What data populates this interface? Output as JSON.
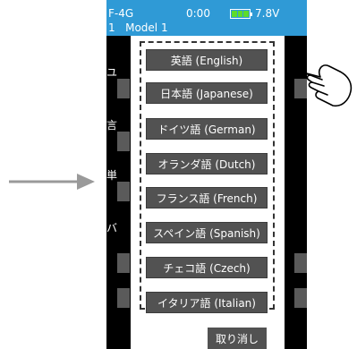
{
  "status_bar": {
    "system": "F-4G",
    "clock": "0:00",
    "voltage": "7.8V",
    "model_number": "1",
    "model_name": "Model 1",
    "battery_icon": "battery-icon"
  },
  "background_labels": [
    "ユ",
    "言",
    "単",
    "バ"
  ],
  "language_options": [
    "英語 (English)",
    "日本語 (Japanese)",
    "ドイツ語 (German)",
    "オランダ語 (Dutch)",
    "フランス語 (French)",
    "スペイン語 (Spanish)",
    "チェコ語 (Czech)",
    "イタリア語 (Italian)"
  ],
  "cancel_label": "取り消し",
  "colors": {
    "status_bar": "#2f9ad6",
    "button": "#525252",
    "battery": "#5ddc2a",
    "arrow": "#9a9a9a"
  },
  "decorations": {
    "arrow_icon": "arrow-right-icon",
    "hand_icon": "pointing-hand-icon"
  }
}
